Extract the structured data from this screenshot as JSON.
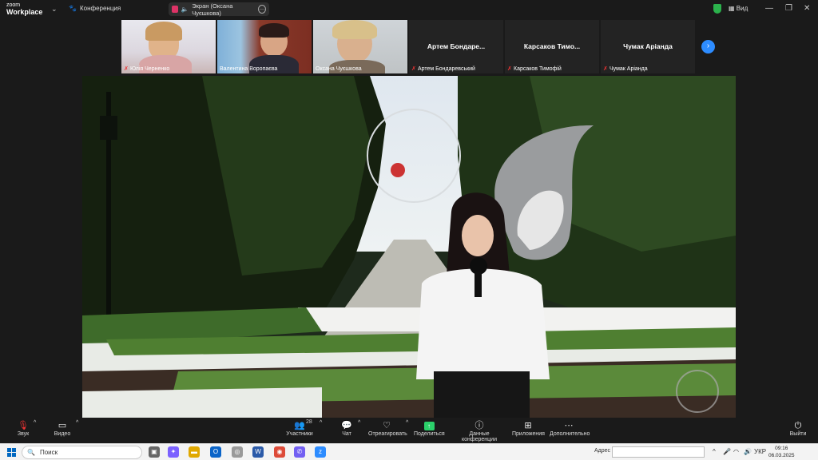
{
  "app": {
    "logo_line1": "zoom",
    "logo_line2": "Workplace",
    "conference_label": "Конференция",
    "screen_share_label": "Экран (Оксана Чуєшкова)",
    "view_label": "Вид"
  },
  "participants": [
    {
      "name": "Юлія Черненко",
      "muted": true,
      "video": true
    },
    {
      "name": "Валентина Воропаєва",
      "muted": false,
      "video": true,
      "active": true
    },
    {
      "name": "Оксана Чуєшкова",
      "muted": false,
      "video": true
    },
    {
      "name": "Артем Бондаревський",
      "display": "Артем  Бондаре...",
      "muted": true,
      "video": false
    },
    {
      "name": "Карсаков Тимофій",
      "display": "Карсаков  Тимо...",
      "muted": true,
      "video": false
    },
    {
      "name": "Чумак Аріанда",
      "display": "Чумак Аріанда",
      "muted": true,
      "video": false
    }
  ],
  "controls": {
    "audio": "Звук",
    "video": "Видео",
    "participants": "Участники",
    "participants_count": "28",
    "chat": "Чат",
    "react": "Отреагировать",
    "share": "Поделиться",
    "conference_data": "Данные конференции",
    "apps": "Приложения",
    "more": "Дополнительно",
    "leave": "Выйти"
  },
  "taskbar": {
    "search_placeholder": "Поиск",
    "address_label": "Адрес",
    "lang": "УКР",
    "time": "09:16",
    "date": "06.03.2025"
  },
  "colors": {
    "accent_green": "#2bd06a",
    "zoom_blue": "#2d8cff",
    "mute_red": "#e33333"
  }
}
